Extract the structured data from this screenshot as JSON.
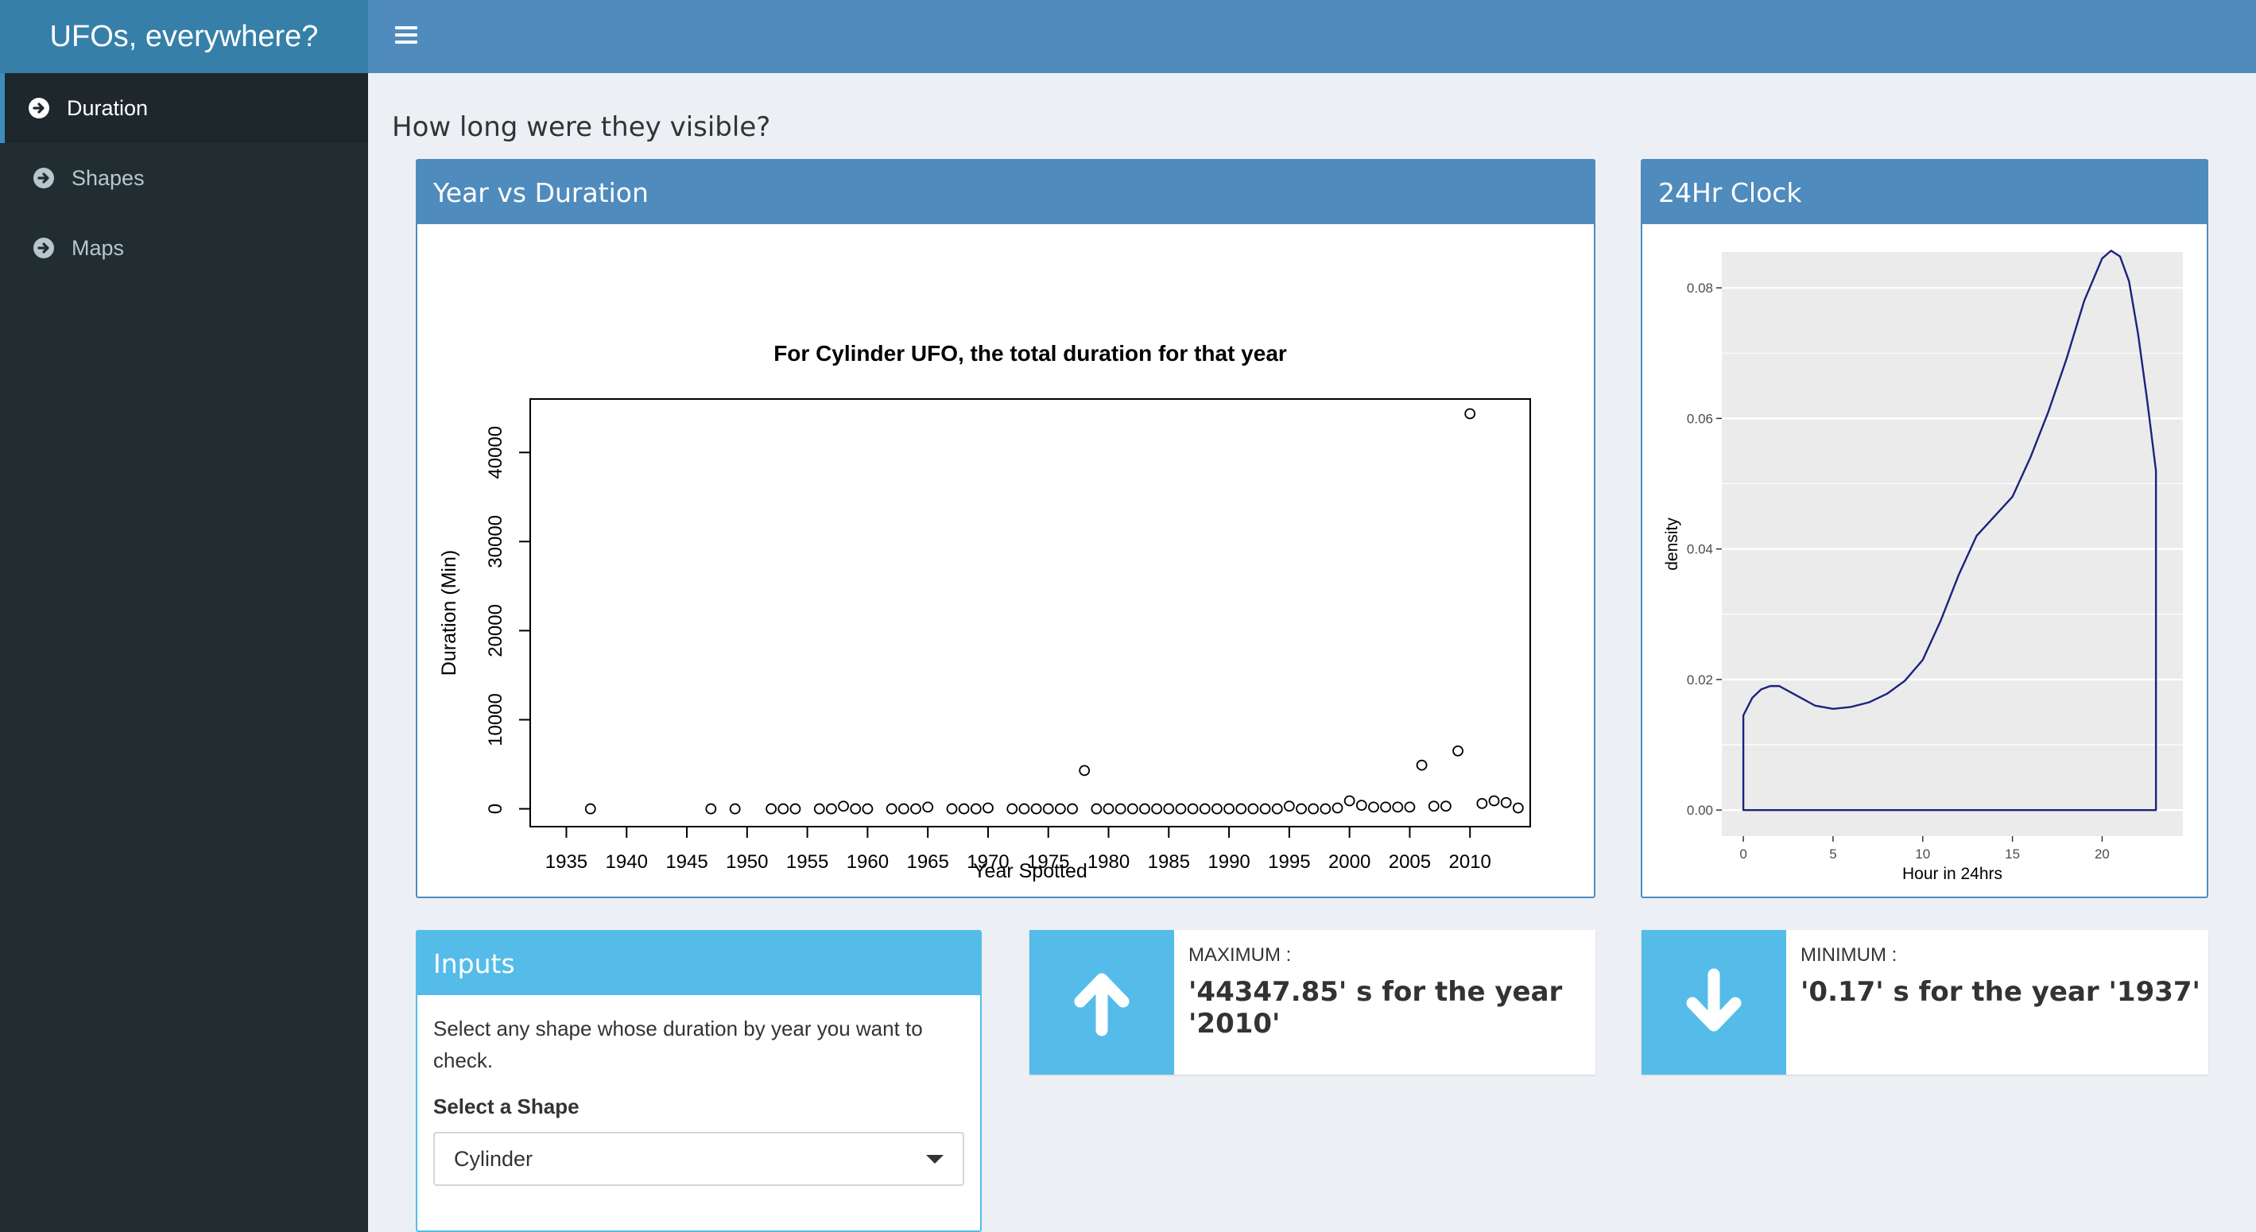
{
  "app": {
    "title": "UFOs, everywhere?"
  },
  "sidebar": {
    "items": [
      {
        "label": "Duration",
        "active": true
      },
      {
        "label": "Shapes",
        "active": false
      },
      {
        "label": "Maps",
        "active": false
      }
    ]
  },
  "page": {
    "heading": "How long were they visible?"
  },
  "boxes": {
    "year": {
      "title": "Year vs Duration"
    },
    "clock": {
      "title": "24Hr Clock"
    },
    "inputs": {
      "title": "Inputs",
      "help": "Select any shape whose duration by year you want to check.",
      "select_label": "Select a Shape",
      "select_value": "Cylinder"
    }
  },
  "info": {
    "max": {
      "label": "MAXIMUM :",
      "value": "'44347.85' s for the year '2010'",
      "icon": "arrow-up-icon"
    },
    "min": {
      "label": "MINIMUM :",
      "value": "'0.17' s for the year '1937'",
      "icon": "arrow-down-icon"
    }
  },
  "colors": {
    "primary": "#4f8bbd",
    "info": "#55bce9",
    "sidebar": "#222d32",
    "line": "#1a237e"
  },
  "chart_data": [
    {
      "type": "scatter",
      "title": "For Cylinder UFO, the total duration for that year",
      "xlabel": "Year Spotted",
      "ylabel": "Duration (Min)",
      "xlim": [
        1932,
        2015
      ],
      "ylim": [
        -2000,
        46000
      ],
      "xticks": [
        1935,
        1940,
        1945,
        1950,
        1955,
        1960,
        1965,
        1970,
        1975,
        1980,
        1985,
        1990,
        1995,
        2000,
        2005,
        2010
      ],
      "yticks": [
        0,
        10000,
        20000,
        30000,
        40000
      ],
      "points": [
        [
          1937,
          0
        ],
        [
          1947,
          0
        ],
        [
          1949,
          0
        ],
        [
          1952,
          0
        ],
        [
          1953,
          0
        ],
        [
          1954,
          0
        ],
        [
          1956,
          0
        ],
        [
          1957,
          0
        ],
        [
          1958,
          300
        ],
        [
          1959,
          0
        ],
        [
          1960,
          0
        ],
        [
          1962,
          0
        ],
        [
          1963,
          0
        ],
        [
          1964,
          0
        ],
        [
          1965,
          200
        ],
        [
          1967,
          0
        ],
        [
          1968,
          0
        ],
        [
          1969,
          0
        ],
        [
          1970,
          100
        ],
        [
          1972,
          0
        ],
        [
          1973,
          0
        ],
        [
          1974,
          0
        ],
        [
          1975,
          0
        ],
        [
          1976,
          0
        ],
        [
          1977,
          0
        ],
        [
          1978,
          4300
        ],
        [
          1979,
          0
        ],
        [
          1980,
          0
        ],
        [
          1981,
          0
        ],
        [
          1982,
          0
        ],
        [
          1983,
          0
        ],
        [
          1984,
          0
        ],
        [
          1985,
          0
        ],
        [
          1986,
          0
        ],
        [
          1987,
          0
        ],
        [
          1988,
          0
        ],
        [
          1989,
          0
        ],
        [
          1990,
          0
        ],
        [
          1991,
          0
        ],
        [
          1992,
          0
        ],
        [
          1993,
          0
        ],
        [
          1994,
          0
        ],
        [
          1995,
          300
        ],
        [
          1996,
          0
        ],
        [
          1997,
          0
        ],
        [
          1998,
          0
        ],
        [
          1999,
          100
        ],
        [
          2000,
          900
        ],
        [
          2001,
          400
        ],
        [
          2002,
          200
        ],
        [
          2003,
          200
        ],
        [
          2004,
          200
        ],
        [
          2005,
          200
        ],
        [
          2006,
          4900
        ],
        [
          2007,
          300
        ],
        [
          2008,
          300
        ],
        [
          2009,
          6500
        ],
        [
          2010,
          44347.85
        ],
        [
          2011,
          600
        ],
        [
          2012,
          900
        ],
        [
          2013,
          700
        ],
        [
          2014,
          100
        ]
      ]
    },
    {
      "type": "area",
      "ylabel": "density",
      "xlabel": "Hour in 24hrs",
      "xlim": [
        -1.2,
        24.5
      ],
      "ylim": [
        -0.004,
        0.0855
      ],
      "xticks": [
        0,
        5,
        10,
        15,
        20
      ],
      "yticks": [
        0.0,
        0.02,
        0.04,
        0.06,
        0.08
      ],
      "ytick_labels": [
        "0.00",
        "0.02",
        "0.04",
        "0.06",
        "0.08"
      ],
      "x": [
        0,
        0.5,
        1,
        1.5,
        2,
        3,
        4,
        5,
        6,
        7,
        8,
        9,
        10,
        11,
        12,
        13,
        14,
        15,
        16,
        17,
        18,
        19,
        20,
        20.5,
        21,
        21.5,
        22,
        22.5,
        23
      ],
      "y": [
        0.0145,
        0.0172,
        0.0185,
        0.019,
        0.019,
        0.0175,
        0.016,
        0.0155,
        0.0158,
        0.0165,
        0.0178,
        0.0198,
        0.023,
        0.029,
        0.036,
        0.042,
        0.045,
        0.048,
        0.054,
        0.061,
        0.069,
        0.078,
        0.0845,
        0.0857,
        0.0848,
        0.081,
        0.073,
        0.063,
        0.052
      ]
    }
  ]
}
